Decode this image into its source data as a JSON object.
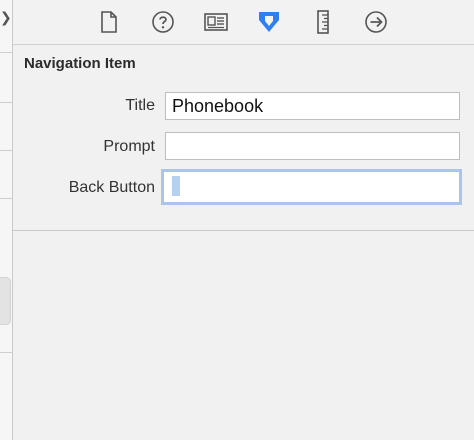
{
  "toolbar": {
    "tabs": [
      {
        "icon": "file-icon"
      },
      {
        "icon": "help-icon"
      },
      {
        "icon": "identity-icon"
      },
      {
        "icon": "attributes-icon",
        "active": true
      },
      {
        "icon": "size-ruler-icon"
      },
      {
        "icon": "connections-icon"
      }
    ],
    "accent_color": "#2f7ef2"
  },
  "inspector": {
    "section_title": "Navigation Item",
    "title_label": "Title",
    "title_value": "Phonebook",
    "prompt_label": "Prompt",
    "prompt_value": "",
    "back_button_label": "Back Button",
    "back_button_value": ""
  }
}
